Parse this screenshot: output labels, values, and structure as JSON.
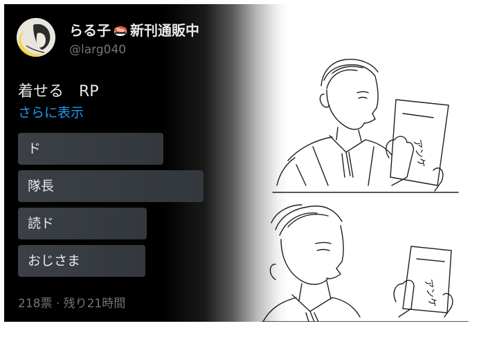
{
  "tweet": {
    "display_name": "らる子",
    "badge_text": "新刊通販中",
    "handle": "@larg040",
    "text": "着せる　RP",
    "show_more": "さらに表示"
  },
  "poll": {
    "options": [
      {
        "label": "ド",
        "fill": 0.62
      },
      {
        "label": "隊長",
        "fill": 0.77
      },
      {
        "label": "読ド",
        "fill": 0.55
      },
      {
        "label": "おじさま",
        "fill": 0.54
      }
    ],
    "meta": "218票 · 残り21時間"
  },
  "sticker_1": "アンケ",
  "sticker_2": "アンケ",
  "colors": {
    "text": "#e7e9ea",
    "muted": "#71767b",
    "link": "#1d9bf0",
    "poll_bar": "#3b4046"
  }
}
